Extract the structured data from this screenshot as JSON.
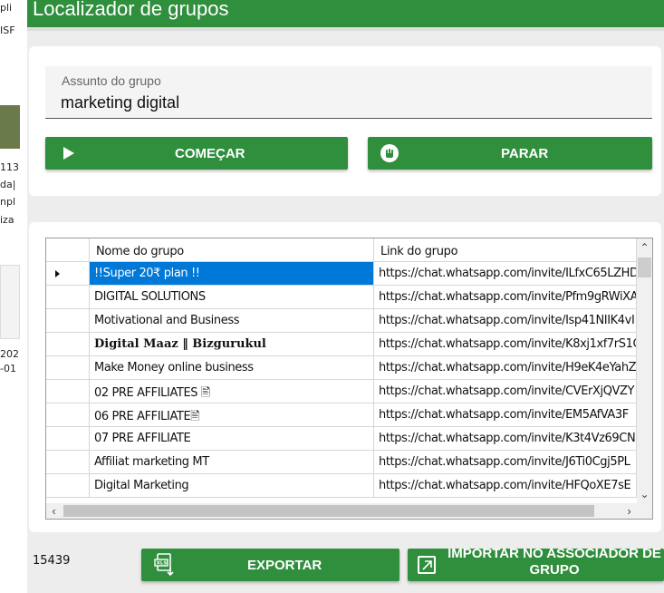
{
  "background": {
    "snippets": [
      "pli",
      "ISF",
      "113",
      "da|",
      "npl",
      "iza",
      "202",
      "-01"
    ]
  },
  "app": {
    "title": "Localizador de grupos"
  },
  "search": {
    "label": "Assunto do grupo",
    "value": "marketing digital"
  },
  "actions": {
    "start_label": "COMEÇAR",
    "stop_label": "PARAR"
  },
  "grid": {
    "columns": [
      "Nome do grupo",
      "Link do grupo"
    ],
    "rows": [
      {
        "name": "!!Super 20₹ plan !!",
        "link": "https://chat.whatsapp.com/invite/ILfxC65LZHD"
      },
      {
        "name": "DIGITAL SOLUTIONS",
        "link": "https://chat.whatsapp.com/invite/Pfm9gRWiXA"
      },
      {
        "name": "Motivational and Business",
        "link": "https://chat.whatsapp.com/invite/Isp41NIIK4vI"
      },
      {
        "name": "Digital Maaz ‖ Bizgurukul",
        "link": "https://chat.whatsapp.com/invite/K8xj1xf7rS1C"
      },
      {
        "name": "Make Money online business",
        "link": "https://chat.whatsapp.com/invite/H9eK4eYahZ"
      },
      {
        "name": "02 PRE AFFILIATES 🖹",
        "link": "https://chat.whatsapp.com/invite/CVErXjQVZY"
      },
      {
        "name": "06 PRE AFFILIATE🖹",
        "link": "https://chat.whatsapp.com/invite/EM5AfVA3F"
      },
      {
        "name": "07 PRE AFFILIATE",
        "link": "https://chat.whatsapp.com/invite/K3t4Vz69CN"
      },
      {
        "name": "Affiliat marketing MT",
        "link": "https://chat.whatsapp.com/invite/J6Ti0Cgj5PL"
      },
      {
        "name": "Digital Marketing",
        "link": "https://chat.whatsapp.com/invite/HFQoXE7sE"
      }
    ],
    "selected_row": 0
  },
  "footer": {
    "count": "15439",
    "export_label": "EXPORTAR",
    "import_label": "IMPORTAR NO ASSOCIADOR DE GRUPO"
  },
  "colors": {
    "accent": "#2f8f3c",
    "selection": "#0078d7",
    "panel": "#ffffff",
    "window": "#ededed"
  },
  "icons": [
    "play-icon",
    "hand-stop-icon",
    "xls-export-icon",
    "external-link-icon",
    "row-pointer-icon"
  ]
}
